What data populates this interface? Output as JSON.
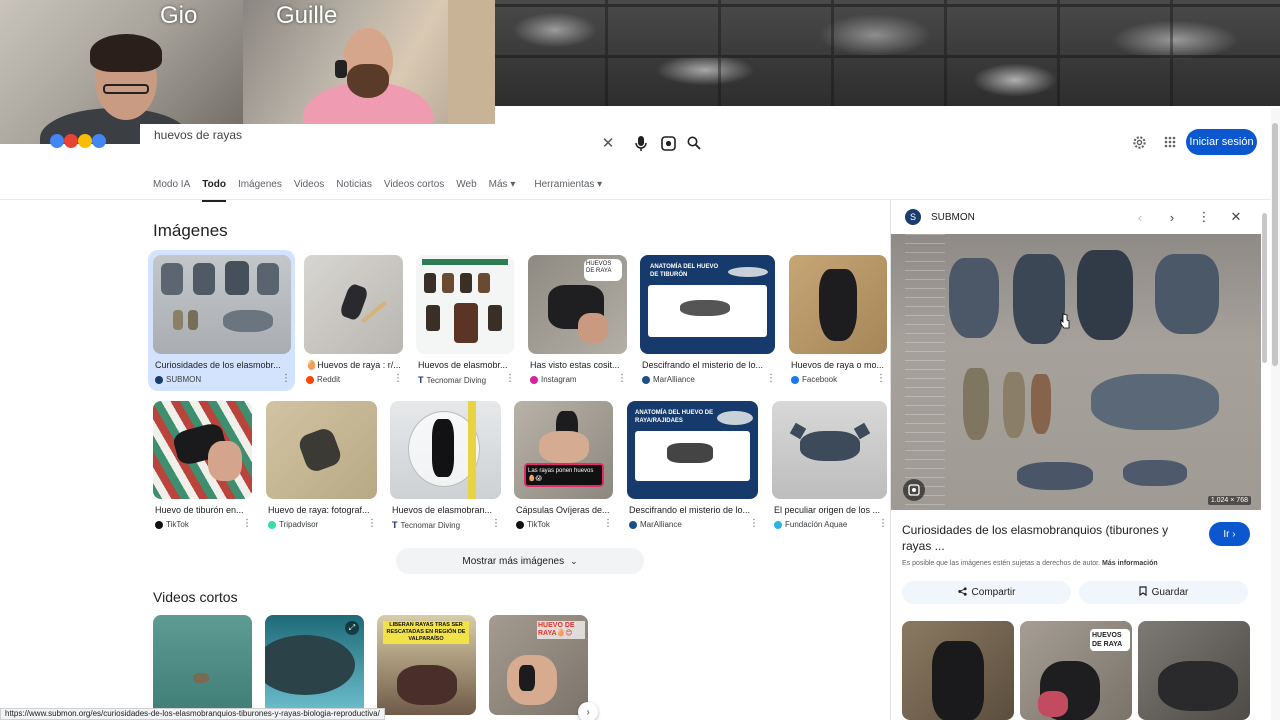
{
  "webcams": [
    {
      "name": "Gio"
    },
    {
      "name": "Guille"
    }
  ],
  "search": {
    "query": "huevos de rayas",
    "clear_icon": "close-icon",
    "voice_icon": "mic-icon",
    "lens_icon": "camera-lens-icon",
    "search_icon": "search-icon"
  },
  "header": {
    "settings_icon": "gear-icon",
    "apps_icon": "grid-apps-icon",
    "signin_label": "Iniciar sesión"
  },
  "tabs": [
    {
      "label": "Modo IA",
      "active": false
    },
    {
      "label": "Todo",
      "active": true
    },
    {
      "label": "Imágenes",
      "active": false
    },
    {
      "label": "Videos",
      "active": false
    },
    {
      "label": "Noticias",
      "active": false
    },
    {
      "label": "Videos cortos",
      "active": false
    },
    {
      "label": "Web",
      "active": false
    },
    {
      "label": "Más ▾",
      "active": false
    },
    {
      "label": "Herramientas ▾",
      "active": false
    }
  ],
  "images_section": {
    "title": "Imágenes",
    "row1": [
      {
        "title": "Curiosidades de los elasmobr...",
        "source": "SUBMON",
        "selected": true
      },
      {
        "title": "🥚Huevos de raya : r/...",
        "source": "Reddit"
      },
      {
        "title": "Huevos de elasmobr...",
        "source": "Tecnomar Diving"
      },
      {
        "title": "Has visto estas cosit...",
        "source": "Instagram"
      },
      {
        "title": "Descifrando el misterio de lo...",
        "source": "MarAlliance"
      },
      {
        "title": "Huevos de raya o mo...",
        "source": "Facebook"
      }
    ],
    "row2": [
      {
        "title": "Huevo de tiburón en...",
        "source": "TikTok"
      },
      {
        "title": "Huevo de raya: fotograf...",
        "source": "Tripadvisor"
      },
      {
        "title": "Huevos de elasmobran...",
        "source": "Tecnomar Diving"
      },
      {
        "title": "Cápsulas Ovíjeras de...",
        "source": "TikTok"
      },
      {
        "title": "Descifrando el misterio de lo...",
        "source": "MarAlliance"
      },
      {
        "title": "El peculiar origen de los ...",
        "source": "Fundación Aquae"
      }
    ],
    "thumb_text": {
      "huevos_de_raya": "HUEVOS DE RAYA",
      "anatomia_tiburon": "ANATOMÍA DEL HUEVO DE TIBURÓN",
      "anatomia_raya": "ANATOMÍA DEL HUEVO DE RAYA/RAJIDAES",
      "rayas_ponen": "Las rayas ponen huevos 🥚😱"
    },
    "show_more": "Mostrar más imágenes"
  },
  "videos_section": {
    "title": "Videos cortos",
    "thumb_text": {
      "liberan": "LIBERAN RAYAS TRAS SER RESCATADAS EN REGIÓN DE VALPARAÍSO",
      "huevo_raya": "HUEVO DE RAYA🥚😊"
    }
  },
  "status_url": "https://www.submon.org/es/curiosidades-de-los-elasmobranquios-tiburones-y-rayas-biologia-reproductiva/",
  "panel": {
    "source": "SUBMON",
    "image_dims": "1.024 × 768",
    "title": "Curiosidades de los elasmobranquios (tiburones y rayas ...",
    "go_label": "Ir ›",
    "copyright": "Es posible que las imágenes estén sujetas a derechos de autor.",
    "more_info": "Más información",
    "share_label": "Compartir",
    "save_label": "Guardar",
    "related_text": "HUEVOS DE RAYA"
  }
}
